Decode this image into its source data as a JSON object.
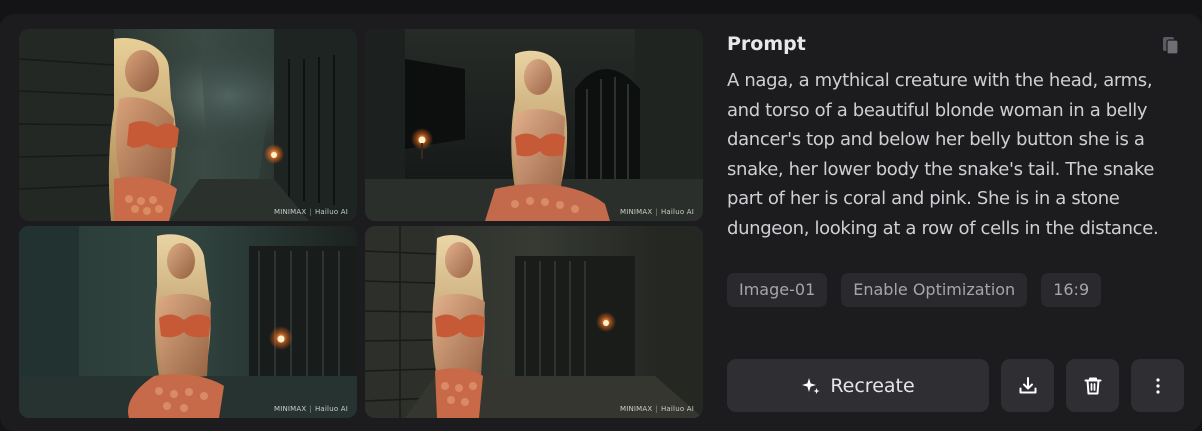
{
  "card": {
    "title": "Prompt",
    "copy_icon": "copy-icon",
    "prompt_text": "A naga, a mythical creature with the head, arms, and torso of a beautiful blonde woman in a belly dancer's top and below her belly button she is a snake, her lower body the snake's tail. The snake part of her is coral and pink. She is in a stone dungeon, looking at a row of cells in the distance.",
    "tags": [
      "Image-01",
      "Enable Optimization",
      "16:9"
    ],
    "actions": {
      "recreate_label": "Recreate",
      "recreate_icon": "sparkle-icon",
      "download_icon": "download-icon",
      "delete_icon": "trash-icon",
      "more_icon": "more-vertical-icon"
    }
  },
  "images": [
    {
      "watermark_brand": "MINIMAX",
      "watermark_product": "Hailuo AI"
    },
    {
      "watermark_brand": "MINIMAX",
      "watermark_product": "Hailuo AI"
    },
    {
      "watermark_brand": "MINIMAX",
      "watermark_product": "Hailuo AI"
    },
    {
      "watermark_brand": "MINIMAX",
      "watermark_product": "Hailuo AI"
    }
  ],
  "colors": {
    "page_background": "#141417",
    "card_background": "#1c1c1f",
    "tag_background": "#2a2a2e",
    "button_background": "#2e2e33"
  }
}
